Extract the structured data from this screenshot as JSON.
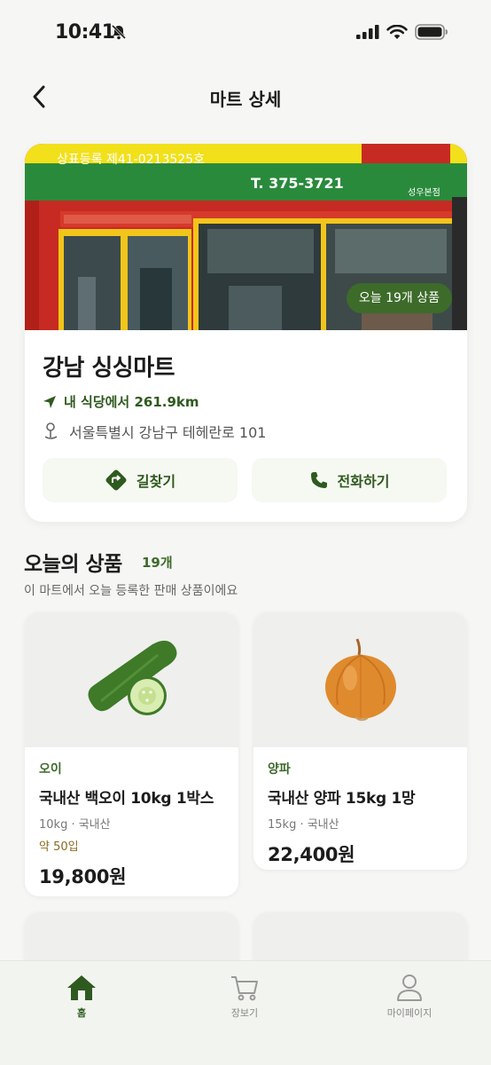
{
  "status": {
    "time": "10:41"
  },
  "nav": {
    "title": "마트 상세"
  },
  "store": {
    "sign_registration": "상표등록 제41-0213525호",
    "sign_phone": "T. 375-3721",
    "sign_branch": "성우본점",
    "today_chip": "오늘 19개 상품",
    "name": "강남 싱싱마트",
    "distance": "내 식당에서 261.9km",
    "address": "서울특별시 강남구 테헤란로 101",
    "directions_label": "길찾기",
    "call_label": "전화하기"
  },
  "section": {
    "title": "오늘의 상품",
    "count": "19개",
    "subtitle": "이 마트에서 오늘 등록한 판매 상품이에요"
  },
  "products": [
    {
      "category": "오이",
      "name": "국내산 백오이 10kg 1박스",
      "meta": "10kg · 국내산",
      "qty": "약 50입",
      "price": "19,800원",
      "image_icon": "cucumber-icon"
    },
    {
      "category": "양파",
      "name": "국내산 양파 15kg 1망",
      "meta": "15kg · 국내산",
      "price": "22,400원",
      "image_icon": "onion-icon"
    }
  ],
  "tabs": [
    {
      "label": "홈",
      "icon": "home-icon",
      "active": true
    },
    {
      "label": "장보기",
      "icon": "cart-icon"
    },
    {
      "label": "마이페이지",
      "icon": "person-icon"
    }
  ],
  "colors": {
    "accent": "#3d6b2a",
    "background": "#f6f6f4",
    "storefront_red": "#c72a22",
    "sign_yellow": "#f2e01a",
    "sign_green": "#2a8a3c"
  }
}
